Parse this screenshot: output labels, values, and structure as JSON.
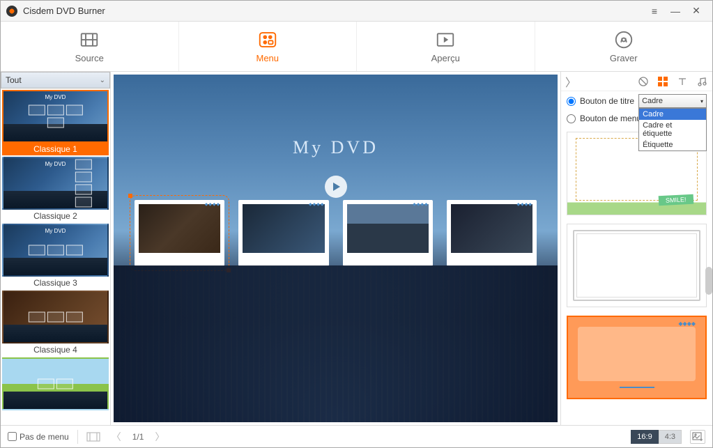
{
  "app": {
    "title": "Cisdem DVD Burner"
  },
  "nav": {
    "tabs": [
      {
        "label": "Source"
      },
      {
        "label": "Menu"
      },
      {
        "label": "Aperçu"
      },
      {
        "label": "Graver"
      }
    ],
    "active_index": 1
  },
  "sidebar": {
    "category_label": "Tout",
    "templates": [
      {
        "label": "Classique 1",
        "mini_title": "My DVD"
      },
      {
        "label": "Classique 2",
        "mini_title": "My DVD"
      },
      {
        "label": "Classique 3",
        "mini_title": "My DVD"
      },
      {
        "label": "Classique 4",
        "mini_title": ""
      },
      {
        "label": "",
        "mini_title": ""
      }
    ],
    "selected_index": 0
  },
  "canvas": {
    "title": "My DVD",
    "thumb_selected_index": 0
  },
  "rpanel": {
    "radio_title_label": "Bouton de titre",
    "radio_menu_label": "Bouton de menu",
    "radio_selected": "title",
    "select_value": "Cadre",
    "select_options": [
      "Cadre",
      "Cadre et étiquette",
      "Étiquette"
    ],
    "select_selected_index": 0,
    "frame_tag": "SMILE!"
  },
  "bottom": {
    "no_menu_label": "Pas de menu",
    "no_menu_checked": false,
    "page": "1/1",
    "ratio_169": "16:9",
    "ratio_43": "4:3",
    "ratio_active": "16:9"
  }
}
